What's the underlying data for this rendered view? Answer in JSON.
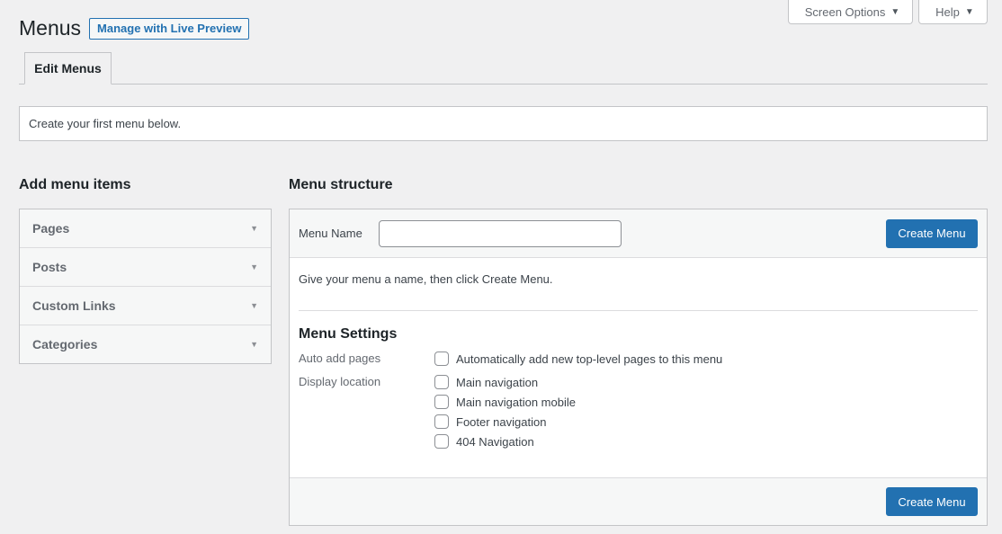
{
  "page": {
    "title": "Menus",
    "live_preview": "Manage with Live Preview"
  },
  "screen_meta": {
    "screen_options": "Screen Options",
    "help": "Help"
  },
  "tabs": [
    {
      "label": "Edit Menus",
      "active": true
    }
  ],
  "notice": "Create your first menu below.",
  "left": {
    "title": "Add menu items",
    "items": [
      "Pages",
      "Posts",
      "Custom Links",
      "Categories"
    ]
  },
  "right": {
    "title": "Menu structure",
    "menu_name_label": "Menu Name",
    "menu_name_value": "",
    "create_button": "Create Menu",
    "instructions": "Give your menu a name, then click Create Menu.",
    "settings_title": "Menu Settings",
    "auto_add_label": "Auto add pages",
    "auto_add_option": "Automatically add new top-level pages to this menu",
    "display_location_label": "Display location",
    "locations": [
      "Main navigation",
      "Main navigation mobile",
      "Footer navigation",
      "404 Navigation"
    ]
  },
  "colors": {
    "primary": "#2271b1",
    "background": "#f0f0f1",
    "border": "#c3c4c7"
  }
}
